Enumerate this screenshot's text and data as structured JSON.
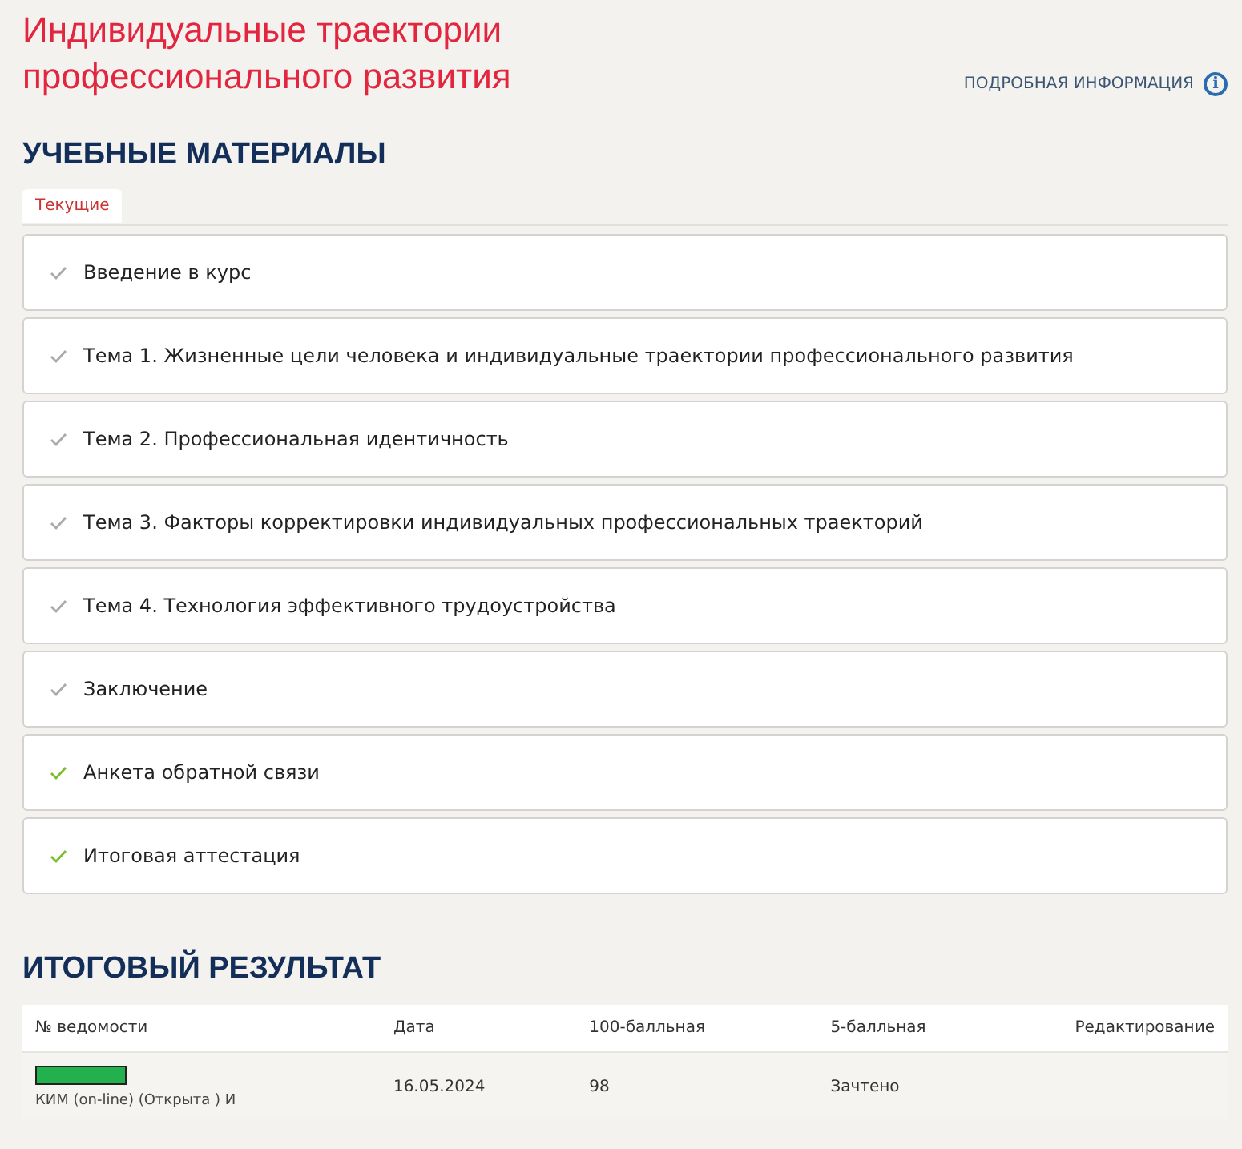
{
  "title": "Индивидуальные траектории профессионального развития",
  "info_link": {
    "label": "ПОДРОБНАЯ ИНФОРМАЦИЯ",
    "icon": "i"
  },
  "materials": {
    "heading": "УЧЕБНЫЕ МАТЕРИАЛЫ",
    "tabs": [
      {
        "label": "Текущие",
        "selected": true
      }
    ],
    "items": [
      {
        "label": "Введение в курс",
        "completed": false
      },
      {
        "label": "Тема 1. Жизненные цели человека и индивидуальные траектории профессионального развития",
        "completed": false
      },
      {
        "label": "Тема 2. Профессиональная идентичность",
        "completed": false
      },
      {
        "label": "Тема 3. Факторы корректировки индивидуальных профессиональных траекторий",
        "completed": false
      },
      {
        "label": "Тема 4. Технология эффективного трудоустройства",
        "completed": false
      },
      {
        "label": "Заключение",
        "completed": false
      },
      {
        "label": "Анкета обратной связи",
        "completed": true
      },
      {
        "label": "Итоговая аттестация",
        "completed": true
      }
    ]
  },
  "result": {
    "heading": "ИТОГОВЫЙ РЕЗУЛЬТАТ",
    "table": {
      "columns": [
        "№ ведомости",
        "Дата",
        "100-балльная",
        "5-балльная",
        "Редактирование"
      ],
      "rows": [
        {
          "sheet": "КИМ (on-line) (Открыта ) И",
          "date": "16.05.2024",
          "score_100": "98",
          "score_5": "Зачтено"
        }
      ]
    }
  }
}
